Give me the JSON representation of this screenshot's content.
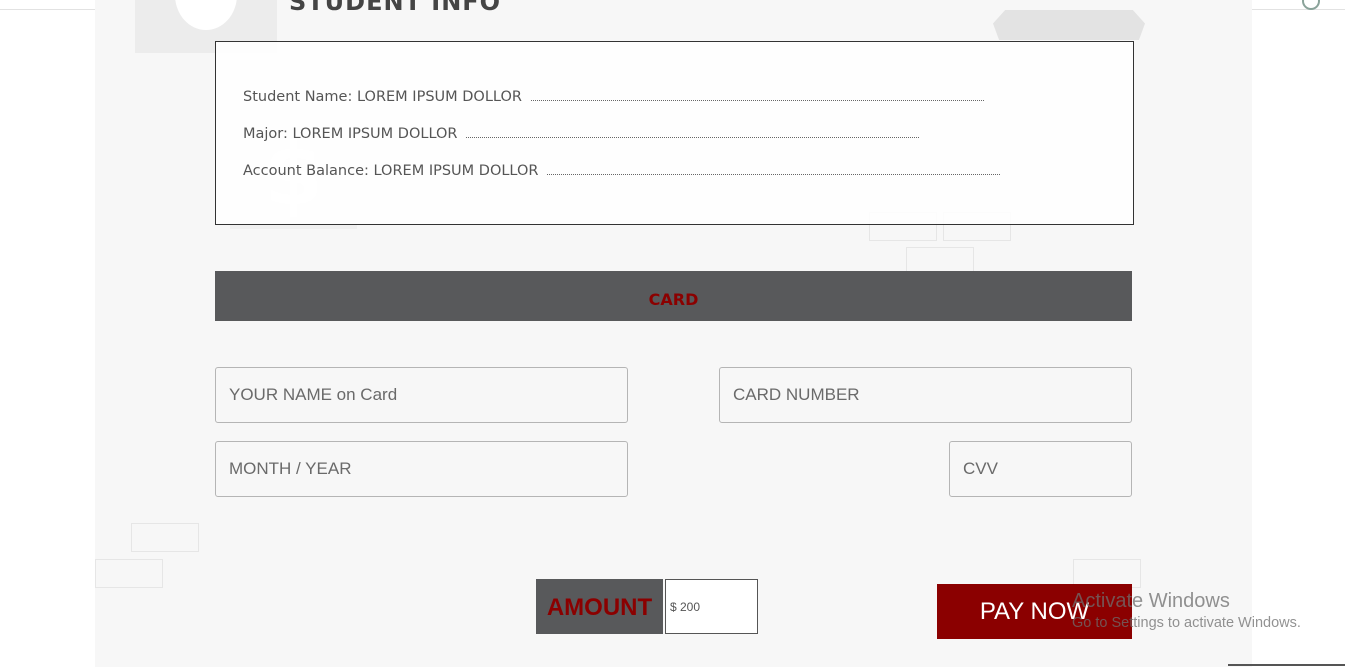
{
  "header": {
    "title": "STUDENT INFO"
  },
  "student_info": {
    "rows": [
      {
        "label": "Student Name:",
        "value": "LOREM IPSUM DOLLOR"
      },
      {
        "label": "Major:",
        "value": "LOREM IPSUM DOLLOR"
      },
      {
        "label": "Account Balance:",
        "value": "LOREM IPSUM DOLLOR"
      }
    ]
  },
  "card_section": {
    "title": "CARD",
    "name_placeholder": "YOUR NAME on Card",
    "number_placeholder": "CARD NUMBER",
    "expiry_placeholder": "MONTH / YEAR",
    "cvv_placeholder": "CVV"
  },
  "payment": {
    "amount_label": "AMOUNT",
    "amount_value": "$ 200",
    "pay_label": "PAY NOW"
  },
  "os_watermark": {
    "title": "Activate Windows",
    "subtitle": "Go to Settings to activate Windows."
  },
  "colors": {
    "accent": "#8b0000",
    "bar": "#58595b",
    "background": "#f7f7f7"
  }
}
